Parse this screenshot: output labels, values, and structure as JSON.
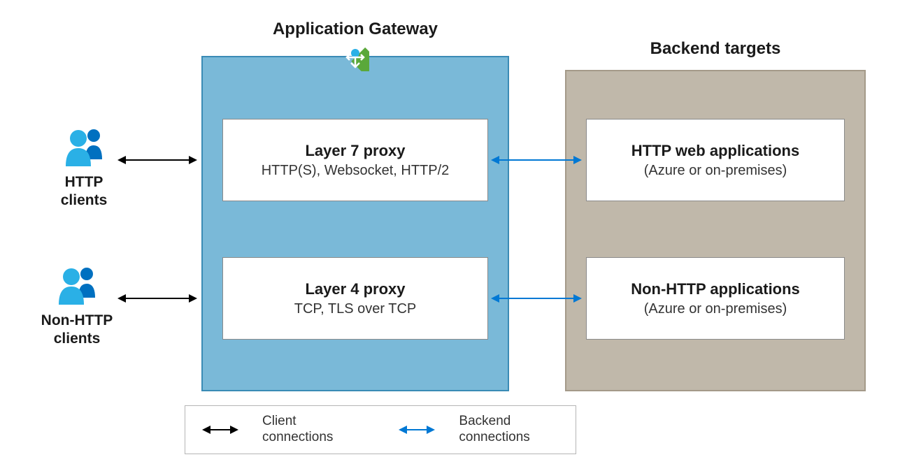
{
  "clients": {
    "http": {
      "label": "HTTP\nclients"
    },
    "nonhttp": {
      "label": "Non-HTTP\nclients"
    }
  },
  "gateway": {
    "title": "Application Gateway",
    "layer7": {
      "title": "Layer 7 proxy",
      "sub": "HTTP(S), Websocket, HTTP/2"
    },
    "layer4": {
      "title": "Layer 4 proxy",
      "sub": "TCP, TLS over TCP"
    }
  },
  "backend": {
    "title": "Backend targets",
    "http": {
      "title": "HTTP web applications",
      "sub": "(Azure or on-premises)"
    },
    "nonhttp": {
      "title": "Non-HTTP applications",
      "sub": "(Azure or on-premises)"
    }
  },
  "legend": {
    "client": "Client\nconnections",
    "backend": "Backend\nconnections"
  }
}
